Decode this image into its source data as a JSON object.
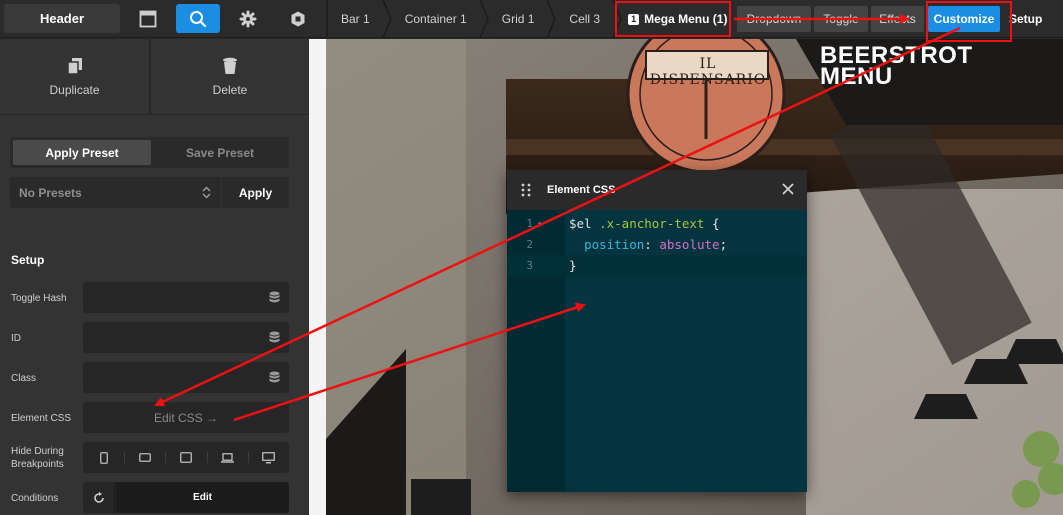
{
  "toolbar": {
    "title": "Header",
    "icons": [
      "layout-icon",
      "search-icon",
      "gear-icon",
      "hexagon-icon"
    ]
  },
  "breadcrumbs": [
    "Bar 1",
    "Container 1",
    "Grid 1",
    "Cell 3"
  ],
  "mega_menu": {
    "badge": "1",
    "label": "Mega Menu (1)"
  },
  "tabs": [
    "Dropdown",
    "Toggle",
    "Effects"
  ],
  "customize_label": "Customize",
  "setup_tab_label": "Setup",
  "panel": {
    "duplicate_label": "Duplicate",
    "delete_label": "Delete",
    "apply_preset_label": "Apply Preset",
    "save_preset_label": "Save Preset",
    "preset_select_value": "No Presets",
    "apply_label": "Apply",
    "section_title": "Setup",
    "toggle_hash_label": "Toggle Hash",
    "id_label": "ID",
    "class_label": "Class",
    "element_css_label": "Element CSS",
    "edit_css_label": "Edit CSS →",
    "hide_during_label": "Hide During Breakpoints",
    "conditions_label": "Conditions",
    "conditions_edit_label": "Edit"
  },
  "preview": {
    "logo_text": "IL DISPENSARIO",
    "title_line1": "BEERSTROT",
    "title_line2": "MENU"
  },
  "css_modal": {
    "title": "Element CSS",
    "lines": [
      {
        "num": "1",
        "var": "$el",
        "selector": " .x-anchor-text",
        "tail": " {"
      },
      {
        "num": "2",
        "prop": "position",
        "value": "absolute"
      },
      {
        "num": "3",
        "text": "}"
      }
    ]
  },
  "colors": {
    "accent": "#1b8de3",
    "annotation": "#ee1111",
    "editor_bg": "#03343f"
  }
}
